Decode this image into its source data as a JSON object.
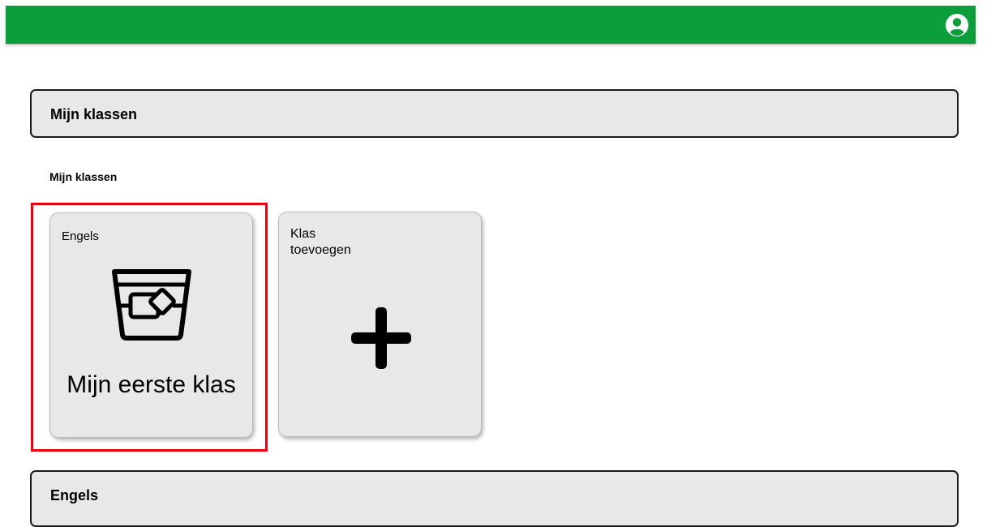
{
  "topbar": {
    "background_color": "#0b9e3a",
    "account_icon": "user-circle-icon"
  },
  "sections": {
    "my_classes_header": "Mijn klassen",
    "my_classes_subheading": "Mijn klassen",
    "engels_header": "Engels"
  },
  "class_cards": [
    {
      "subject": "Engels",
      "name": "Mijn eerste klas",
      "icon": "glass-with-ice-icon",
      "highlighted": true
    }
  ],
  "add_card": {
    "label": "Klas toevoegen",
    "icon": "plus-icon"
  },
  "colors": {
    "highlight_border": "#e8000b",
    "card_background": "#e8e8e8"
  }
}
